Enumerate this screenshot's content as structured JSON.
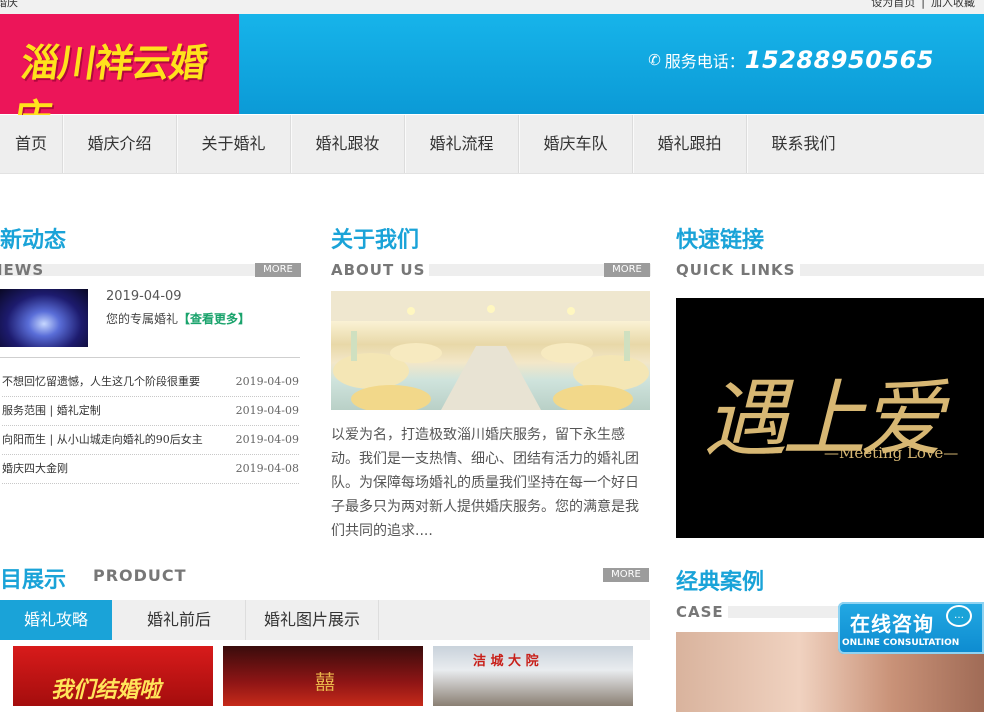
{
  "topbar": {
    "site_name": "婚庆",
    "set_home": "设为首页",
    "divider": "|",
    "add_favorite": "加入收藏"
  },
  "header": {
    "logo_text": "淄川祥云婚庆",
    "phone_label": "服务电话：",
    "phone_number": "15288950565"
  },
  "nav": [
    "首页",
    "婚庆介绍",
    "关于婚礼",
    "婚礼跟妆",
    "婚礼流程",
    "婚庆车队",
    "婚礼跟拍",
    "联系我们"
  ],
  "news": {
    "title_cn": "最新动态",
    "title_en": "NEWS",
    "more": "MORE",
    "featured": {
      "date": "2019-04-09",
      "summary": "您的专属婚礼",
      "link": "【查看更多】"
    },
    "items": [
      {
        "title": "不想回忆留遗憾，人生这几个阶段很重要",
        "date": "2019-04-09"
      },
      {
        "title": "服务范围 | 婚礼定制",
        "date": "2019-04-09"
      },
      {
        "title": "向阳而生 | 从小山城走向婚礼的90后女主",
        "date": "2019-04-09"
      },
      {
        "title": "婚庆四大金刚",
        "date": "2019-04-08"
      }
    ]
  },
  "about": {
    "title_cn": "关于我们",
    "title_en": "ABOUT US",
    "more": "MORE",
    "text": "以爱为名，打造极致淄川婚庆服务，留下永生感动。我们是一支热情、细心、团结有活力的婚礼团队。为保障每场婚礼的质量我们坚持在每一个好日子最多只为两对新人提供婚庆服务。您的满意是我们共同的追求...."
  },
  "quick_links": {
    "title_cn": "快速链接",
    "title_en": "QUICK LINKS",
    "banner_cn": "遇上爱",
    "banner_en": "—Meeting Love—"
  },
  "product": {
    "title_cn": "项目展示",
    "title_en": "PRODUCT",
    "more": "MORE",
    "tabs": [
      "婚礼攻略",
      "婚礼前后",
      "婚礼图片展示"
    ],
    "thumb_texts": [
      "我们结婚啦",
      "囍",
      "洁 城 大 院"
    ]
  },
  "case": {
    "title_cn": "经典案例",
    "title_en": "CASE"
  },
  "chat": {
    "title": "在线咨询",
    "subtitle": "ONLINE CONSULTATION"
  },
  "colors": {
    "brand": "#1aa3d8",
    "logo_bg": "#ec1559",
    "logo_text": "#ffe21c"
  }
}
